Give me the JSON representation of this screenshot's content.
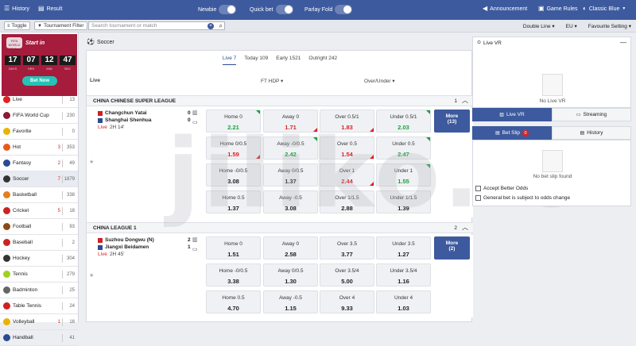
{
  "topbar": {
    "history": "History",
    "result": "Result",
    "newbie": "Newbie",
    "quick_bet": "Quick bet",
    "parlay_fold": "Parlay Fold",
    "announcement": "Announcement",
    "game_rules": "Game Rules",
    "theme": "Classic Blue"
  },
  "subbar": {
    "toggle": "Toggle",
    "tournament_filter": "Tournament Filter",
    "search_placeholder": "Search tournament or match",
    "double_line": "Double Line",
    "odds_type": "EU",
    "favourite_setting": "Favourite Setting"
  },
  "banner": {
    "title": "Start in",
    "logo_text": "FIFA WORLD CUP Qatar 2022",
    "countdown": [
      "17",
      "07",
      "12",
      "47"
    ],
    "units": [
      "DAYS",
      "HRS",
      "MIN",
      "SEC"
    ],
    "bet_now": "Bet Now"
  },
  "sidebar": [
    {
      "label": "Live",
      "badge": "",
      "count": "13",
      "color": "#d22"
    },
    {
      "label": "FIFA World Cup",
      "badge": "",
      "count": "230",
      "color": "#8a1a34"
    },
    {
      "label": "Favorite",
      "badge": "",
      "count": "0",
      "color": "#e8b400"
    },
    {
      "label": "Hot",
      "badge": "3",
      "count": "353",
      "color": "#e85a1a"
    },
    {
      "label": "Fantasy",
      "badge": "2",
      "count": "49",
      "color": "#2b4b93"
    },
    {
      "label": "Soccer",
      "badge": "7",
      "count": "1879",
      "color": "#333"
    },
    {
      "label": "Basketball",
      "badge": "",
      "count": "338",
      "color": "#e2801f"
    },
    {
      "label": "Cricket",
      "badge": "5",
      "count": "18",
      "color": "#c22"
    },
    {
      "label": "Football",
      "badge": "",
      "count": "93",
      "color": "#8a4a1a"
    },
    {
      "label": "Baseball",
      "badge": "",
      "count": "2",
      "color": "#c22"
    },
    {
      "label": "Hockey",
      "badge": "",
      "count": "304",
      "color": "#333"
    },
    {
      "label": "Tennis",
      "badge": "",
      "count": "279",
      "color": "#9fd121"
    },
    {
      "label": "Badminton",
      "badge": "",
      "count": "25",
      "color": "#666"
    },
    {
      "label": "Table Tennis",
      "badge": "",
      "count": "24",
      "color": "#c22"
    },
    {
      "label": "Volleyball",
      "badge": "1",
      "count": "16",
      "color": "#e8b400"
    },
    {
      "label": "Handball",
      "badge": "",
      "count": "41",
      "color": "#2b4b93"
    }
  ],
  "main": {
    "section": "Soccer",
    "tabs": [
      "Live 7",
      "Today 109",
      "Early 1521",
      "Outright 242"
    ],
    "live_label": "Live",
    "col_ft_hdp": "FT HDP",
    "col_over_under": "Over/Under",
    "leagues": [
      {
        "name": "CHINA CHINESE SUPER LEAGUE",
        "count": "1",
        "home": "Changchun Yatai",
        "away": "Shanghai Shenhua",
        "home_score": "0",
        "away_score": "0",
        "live": "Live",
        "time": "2H 14'",
        "more": "More",
        "more_count": "(13)",
        "odds": [
          [
            {
              "l": "Home 0",
              "v": "2.21",
              "c": "up"
            },
            {
              "l": "Away 0",
              "v": "1.71",
              "c": "dn"
            },
            {
              "l": "Over 0.5/1",
              "v": "1.83",
              "c": "dn"
            },
            {
              "l": "Under 0.5/1",
              "v": "2.03",
              "c": "up"
            }
          ],
          [
            {
              "l": "Home 0/0.5",
              "v": "1.59",
              "c": "dn"
            },
            {
              "l": "Away -0/0.5",
              "v": "2.42",
              "c": "up"
            },
            {
              "l": "Over 0.5",
              "v": "1.54",
              "c": "dn"
            },
            {
              "l": "Under 0.5",
              "v": "2.47",
              "c": "up"
            }
          ],
          [
            {
              "l": "Home -0/0.5",
              "v": "3.08",
              "c": ""
            },
            {
              "l": "Away 0/0.5",
              "v": "1.37",
              "c": ""
            },
            {
              "l": "Over 1",
              "v": "2.44",
              "c": "dn"
            },
            {
              "l": "Under 1",
              "v": "1.55",
              "c": "up"
            }
          ],
          [
            {
              "l": "Home 0.5",
              "v": "1.37",
              "c": ""
            },
            {
              "l": "Away -0.5",
              "v": "3.08",
              "c": ""
            },
            {
              "l": "Over 1/1.5",
              "v": "2.88",
              "c": ""
            },
            {
              "l": "Under 1/1.5",
              "v": "1.39",
              "c": ""
            }
          ]
        ]
      },
      {
        "name": "CHINA LEAGUE 1",
        "count": "2",
        "home": "Suzhou Dongwu (N)",
        "away": "Jiangxi Beidamen",
        "home_score": "2",
        "away_score": "1",
        "live": "Live",
        "time": "2H 45'",
        "more": "More",
        "more_count": "(2)",
        "odds": [
          [
            {
              "l": "Home 0",
              "v": "1.51",
              "c": ""
            },
            {
              "l": "Away 0",
              "v": "2.58",
              "c": ""
            },
            {
              "l": "Over 3.5",
              "v": "3.77",
              "c": ""
            },
            {
              "l": "Under 3.5",
              "v": "1.27",
              "c": ""
            }
          ],
          [
            {
              "l": "Home -0/0.5",
              "v": "3.38",
              "c": ""
            },
            {
              "l": "Away 0/0.5",
              "v": "1.30",
              "c": ""
            },
            {
              "l": "Over 3.5/4",
              "v": "5.00",
              "c": ""
            },
            {
              "l": "Under 3.5/4",
              "v": "1.16",
              "c": ""
            }
          ],
          [
            {
              "l": "Home 0.5",
              "v": "4.70",
              "c": ""
            },
            {
              "l": "Away -0.5",
              "v": "1.15",
              "c": ""
            },
            {
              "l": "Over 4",
              "v": "9.33",
              "c": ""
            },
            {
              "l": "Under 4",
              "v": "1.03",
              "c": ""
            }
          ]
        ]
      }
    ]
  },
  "right": {
    "live_vr": "Live VR",
    "no_live_vr": "No Live VR",
    "live_vr_tab": "Live VR",
    "streaming_tab": "Streaming",
    "bet_slip": "Bet Slip",
    "bet_slip_count": "0",
    "history": "History",
    "no_bet_slip": "No bet slip found",
    "accept_better_odds": "Accept Better Odds",
    "general_bet": "General bet is subject to odds change"
  },
  "watermark": "jiliko.io"
}
